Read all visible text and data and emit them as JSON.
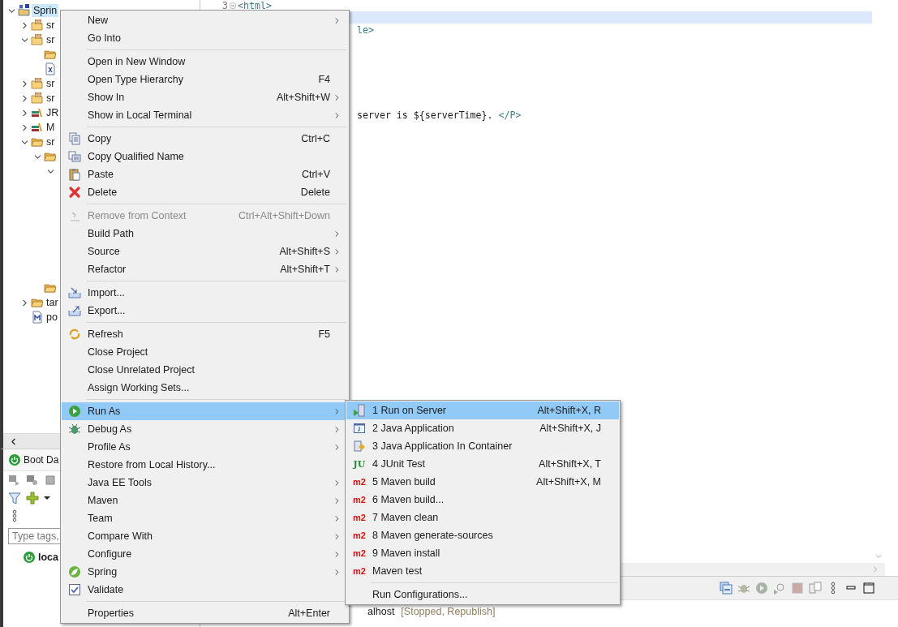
{
  "project_tree": {
    "items": [
      {
        "kind": "project",
        "label": "Sprin",
        "selected": true,
        "expanded": true,
        "children": [
          {
            "kind": "package",
            "label": "sr",
            "expanded": false
          },
          {
            "kind": "package",
            "label": "sr",
            "expanded": true,
            "children": [
              {
                "kind": "folder"
              },
              {
                "kind": "xml"
              }
            ]
          },
          {
            "kind": "package",
            "label": "sr",
            "expanded": false
          },
          {
            "kind": "package",
            "label": "sr",
            "expanded": false
          },
          {
            "kind": "library",
            "label": "JR",
            "expanded": false
          },
          {
            "kind": "library",
            "label": "M",
            "expanded": false
          },
          {
            "kind": "spring-folder",
            "label": "sr",
            "expanded": true,
            "children": [
              {
                "kind": "spring-folder",
                "expanded": true,
                "children": [
                  {
                    "expanded": true
                  }
                ]
              },
              {
                "kind": "folder"
              }
            ]
          },
          {
            "kind": "folder",
            "label": "tar",
            "expanded": false
          },
          {
            "kind": "pom",
            "label": "po"
          }
        ]
      }
    ]
  },
  "boot_dashboard": {
    "title": "Boot Da",
    "search": {
      "placeholder": "Type tags,"
    },
    "apps": [
      {
        "name": "loca"
      }
    ]
  },
  "editor": {
    "lines": [
      {
        "number": "3",
        "segments": [
          {
            "kind": "tag",
            "text": "<html>"
          }
        ],
        "current": false
      },
      {
        "current": true
      },
      {
        "segments": [
          {
            "kind": "tag",
            "text": "le>"
          }
        ],
        "current": false
      },
      {
        "current": false
      },
      {
        "current": false
      },
      {
        "current": false
      },
      {
        "current": false
      },
      {
        "current": false
      },
      {
        "current": false
      },
      {
        "segments": [
          {
            "kind": "text",
            "text": "server is ${serverTime}."
          },
          {
            "kind": "tag",
            "text": "</P>"
          }
        ],
        "current": false
      }
    ]
  },
  "servers_panel": {
    "server": {
      "name": "alhost",
      "status": "[Stopped, Republish]"
    }
  },
  "context_menu": {
    "items": [
      {
        "kind": "item",
        "label": "New",
        "submenu": true,
        "selected": false,
        "disabled": false
      },
      {
        "kind": "item",
        "label": "Go Into",
        "submenu": false,
        "selected": false,
        "disabled": false
      },
      {
        "kind": "separator"
      },
      {
        "kind": "item",
        "label": "Open in New Window",
        "submenu": false,
        "selected": false,
        "disabled": false
      },
      {
        "kind": "item",
        "label": "Open Type Hierarchy",
        "shortcut": "F4",
        "submenu": false,
        "selected": false,
        "disabled": false
      },
      {
        "kind": "item",
        "label": "Show In",
        "shortcut": "Alt+Shift+W",
        "submenu": true,
        "selected": false,
        "disabled": false
      },
      {
        "kind": "item",
        "label": "Show in Local Terminal",
        "submenu": true,
        "selected": false,
        "disabled": false
      },
      {
        "kind": "separator"
      },
      {
        "kind": "item",
        "label": "Copy",
        "shortcut": "Ctrl+C",
        "submenu": false,
        "selected": false,
        "disabled": false
      },
      {
        "kind": "item",
        "label": "Copy Qualified Name",
        "submenu": false,
        "selected": false,
        "disabled": false
      },
      {
        "kind": "item",
        "label": "Paste",
        "shortcut": "Ctrl+V",
        "submenu": false,
        "selected": false,
        "disabled": false
      },
      {
        "kind": "item",
        "label": "Delete",
        "shortcut": "Delete",
        "submenu": false,
        "selected": false,
        "disabled": false
      },
      {
        "kind": "separator"
      },
      {
        "kind": "item",
        "label": "Remove from Context",
        "shortcut": "Ctrl+Alt+Shift+Down",
        "submenu": false,
        "selected": false,
        "disabled": true
      },
      {
        "kind": "item",
        "label": "Build Path",
        "submenu": true,
        "selected": false,
        "disabled": false
      },
      {
        "kind": "item",
        "label": "Source",
        "shortcut": "Alt+Shift+S",
        "submenu": true,
        "selected": false,
        "disabled": false
      },
      {
        "kind": "item",
        "label": "Refactor",
        "shortcut": "Alt+Shift+T",
        "submenu": true,
        "selected": false,
        "disabled": false
      },
      {
        "kind": "separator"
      },
      {
        "kind": "item",
        "label": "Import...",
        "submenu": false,
        "selected": false,
        "disabled": false
      },
      {
        "kind": "item",
        "label": "Export...",
        "submenu": false,
        "selected": false,
        "disabled": false
      },
      {
        "kind": "separator"
      },
      {
        "kind": "item",
        "label": "Refresh",
        "shortcut": "F5",
        "submenu": false,
        "selected": false,
        "disabled": false
      },
      {
        "kind": "item",
        "label": "Close Project",
        "submenu": false,
        "selected": false,
        "disabled": false
      },
      {
        "kind": "item",
        "label": "Close Unrelated Project",
        "submenu": false,
        "selected": false,
        "disabled": false
      },
      {
        "kind": "item",
        "label": "Assign Working Sets...",
        "submenu": false,
        "selected": false,
        "disabled": false
      },
      {
        "kind": "separator"
      },
      {
        "kind": "item",
        "label": "Run As",
        "submenu": true,
        "selected": true,
        "disabled": false
      },
      {
        "kind": "item",
        "label": "Debug As",
        "submenu": true,
        "selected": false,
        "disabled": false
      },
      {
        "kind": "item",
        "label": "Profile As",
        "submenu": true,
        "selected": false,
        "disabled": false
      },
      {
        "kind": "item",
        "label": "Restore from Local History...",
        "submenu": false,
        "selected": false,
        "disabled": false
      },
      {
        "kind": "item",
        "label": "Java EE Tools",
        "submenu": true,
        "selected": false,
        "disabled": false
      },
      {
        "kind": "item",
        "label": "Maven",
        "submenu": true,
        "selected": false,
        "disabled": false
      },
      {
        "kind": "item",
        "label": "Team",
        "submenu": true,
        "selected": false,
        "disabled": false
      },
      {
        "kind": "item",
        "label": "Compare With",
        "submenu": true,
        "selected": false,
        "disabled": false
      },
      {
        "kind": "item",
        "label": "Configure",
        "submenu": true,
        "selected": false,
        "disabled": false
      },
      {
        "kind": "item",
        "label": "Spring",
        "submenu": true,
        "selected": false,
        "disabled": false
      },
      {
        "kind": "item",
        "label": "Validate",
        "submenu": false,
        "selected": false,
        "disabled": false
      },
      {
        "kind": "separator"
      },
      {
        "kind": "item",
        "label": "Properties",
        "shortcut": "Alt+Enter",
        "submenu": false,
        "selected": false,
        "disabled": false
      }
    ]
  },
  "run_as_menu": {
    "items": [
      {
        "kind": "item",
        "label": "1 Run on Server",
        "shortcut": "Alt+Shift+X, R",
        "selected": true
      },
      {
        "kind": "item",
        "label": "2 Java Application",
        "shortcut": "Alt+Shift+X, J",
        "selected": false
      },
      {
        "kind": "item",
        "label": "3 Java Application In Container",
        "selected": false
      },
      {
        "kind": "item",
        "badge": "JU",
        "label": "4 JUnit Test",
        "shortcut": "Alt+Shift+X, T",
        "selected": false
      },
      {
        "kind": "item",
        "badge": "m2",
        "label": "5 Maven build",
        "shortcut": "Alt+Shift+X, M",
        "selected": false
      },
      {
        "kind": "item",
        "badge": "m2",
        "label": "6 Maven build...",
        "selected": false
      },
      {
        "kind": "item",
        "badge": "m2",
        "label": "7 Maven clean",
        "selected": false
      },
      {
        "kind": "item",
        "badge": "m2",
        "label": "8 Maven generate-sources",
        "selected": false
      },
      {
        "kind": "item",
        "badge": "m2",
        "label": "9 Maven install",
        "selected": false
      },
      {
        "kind": "item",
        "badge": "m2",
        "label": "Maven test",
        "selected": false
      },
      {
        "kind": "separator"
      },
      {
        "kind": "item",
        "label": "Run Configurations...",
        "selected": false
      }
    ]
  }
}
